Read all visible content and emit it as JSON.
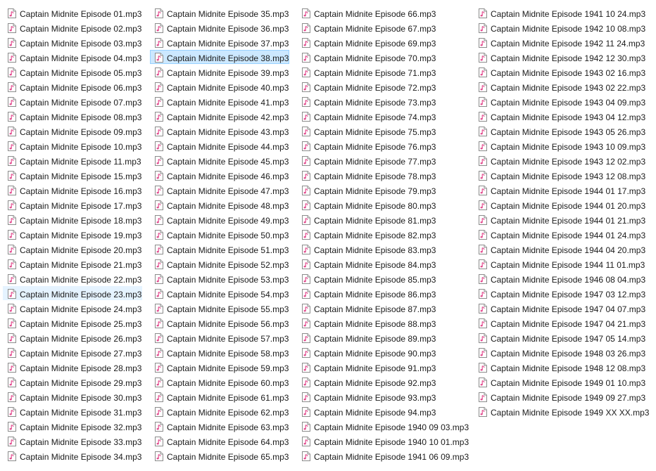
{
  "columns": [
    {
      "items": [
        "Captain Midnite Episode 01.mp3",
        "Captain Midnite Episode 02.mp3",
        "Captain Midnite Episode 03.mp3",
        "Captain Midnite Episode 04.mp3",
        "Captain Midnite Episode 05.mp3",
        "Captain Midnite Episode 06.mp3",
        "Captain Midnite Episode 07.mp3",
        "Captain Midnite Episode 08.mp3",
        "Captain Midnite Episode 09.mp3",
        "Captain Midnite Episode 10.mp3",
        "Captain Midnite Episode 11.mp3",
        "Captain Midnite Episode 15.mp3",
        "Captain Midnite Episode 16.mp3",
        "Captain Midnite Episode 17.mp3",
        "Captain Midnite Episode 18.mp3",
        "Captain Midnite Episode 19.mp3",
        "Captain Midnite Episode 20.mp3",
        "Captain Midnite Episode 21.mp3",
        "Captain Midnite Episode 22.mp3",
        "Captain Midnite Episode 23.mp3",
        "Captain Midnite Episode 24.mp3",
        "Captain Midnite Episode 25.mp3",
        "Captain Midnite Episode 26.mp3",
        "Captain Midnite Episode 27.mp3",
        "Captain Midnite Episode 28.mp3",
        "Captain Midnite Episode 29.mp3",
        "Captain Midnite Episode 30.mp3",
        "Captain Midnite Episode 31.mp3",
        "Captain Midnite Episode 32.mp3",
        "Captain Midnite Episode 33.mp3",
        "Captain Midnite Episode 34.mp3"
      ]
    },
    {
      "items": [
        "Captain Midnite Episode 35.mp3",
        "Captain Midnite Episode 36.mp3",
        "Captain Midnite Episode 37.mp3",
        "Captain Midnite Episode 38.mp3",
        "Captain Midnite Episode 39.mp3",
        "Captain Midnite Episode 40.mp3",
        "Captain Midnite Episode 41.mp3",
        "Captain Midnite Episode 42.mp3",
        "Captain Midnite Episode 43.mp3",
        "Captain Midnite Episode 44.mp3",
        "Captain Midnite Episode 45.mp3",
        "Captain Midnite Episode 46.mp3",
        "Captain Midnite Episode 47.mp3",
        "Captain Midnite Episode 48.mp3",
        "Captain Midnite Episode 49.mp3",
        "Captain Midnite Episode 50.mp3",
        "Captain Midnite Episode 51.mp3",
        "Captain Midnite Episode 52.mp3",
        "Captain Midnite Episode 53.mp3",
        "Captain Midnite Episode 54.mp3",
        "Captain Midnite Episode 55.mp3",
        "Captain Midnite Episode 56.mp3",
        "Captain Midnite Episode 57.mp3",
        "Captain Midnite Episode 58.mp3",
        "Captain Midnite Episode 59.mp3",
        "Captain Midnite Episode 60.mp3",
        "Captain Midnite Episode 61.mp3",
        "Captain Midnite Episode 62.mp3",
        "Captain Midnite Episode 63.mp3",
        "Captain Midnite Episode 64.mp3",
        "Captain Midnite Episode 65.mp3"
      ]
    },
    {
      "items": [
        "Captain Midnite Episode 66.mp3",
        "Captain Midnite Episode 67.mp3",
        "Captain Midnite Episode 69.mp3",
        "Captain Midnite Episode 70.mp3",
        "Captain Midnite Episode 71.mp3",
        "Captain Midnite Episode 72.mp3",
        "Captain Midnite Episode 73.mp3",
        "Captain Midnite Episode 74.mp3",
        "Captain Midnite Episode 75.mp3",
        "Captain Midnite Episode 76.mp3",
        "Captain Midnite Episode 77.mp3",
        "Captain Midnite Episode 78.mp3",
        "Captain Midnite Episode 79.mp3",
        "Captain Midnite Episode 80.mp3",
        "Captain Midnite Episode 81.mp3",
        "Captain Midnite Episode 82.mp3",
        "Captain Midnite Episode 83.mp3",
        "Captain Midnite Episode 84.mp3",
        "Captain Midnite Episode 85.mp3",
        "Captain Midnite Episode 86.mp3",
        "Captain Midnite Episode 87.mp3",
        "Captain Midnite Episode 88.mp3",
        "Captain Midnite Episode 89.mp3",
        "Captain Midnite Episode 90.mp3",
        "Captain Midnite Episode 91.mp3",
        "Captain Midnite Episode 92.mp3",
        "Captain Midnite Episode 93.mp3",
        "Captain Midnite Episode 94.mp3",
        "Captain Midnite Episode 1940 09 03.mp3",
        "Captain Midnite Episode 1940 10 01.mp3",
        "Captain Midnite Episode 1941 06 09.mp3"
      ]
    },
    {
      "items": [
        "Captain Midnite Episode 1941 10 24.mp3",
        "Captain Midnite Episode 1942 10 08.mp3",
        "Captain Midnite Episode 1942 11 24.mp3",
        "Captain Midnite Episode 1942 12 30.mp3",
        "Captain Midnite Episode 1943 02 16.mp3",
        "Captain Midnite Episode 1943 02 22.mp3",
        "Captain Midnite Episode 1943 04 09.mp3",
        "Captain Midnite Episode 1943 04 12.mp3",
        "Captain Midnite Episode 1943 05 26.mp3",
        "Captain Midnite Episode 1943 10 09.mp3",
        "Captain Midnite Episode 1943 12 02.mp3",
        "Captain Midnite Episode 1943 12 08.mp3",
        "Captain Midnite Episode 1944 01 17.mp3",
        "Captain Midnite Episode 1944 01 20.mp3",
        "Captain Midnite Episode 1944 01 21.mp3",
        "Captain Midnite Episode 1944 01 24.mp3",
        "Captain Midnite Episode 1944 04 20.mp3",
        "Captain Midnite Episode 1944 11 01.mp3",
        "Captain Midnite Episode 1946 08 04.mp3",
        "Captain Midnite Episode 1947 03 12.mp3",
        "Captain Midnite Episode 1947 04 07.mp3",
        "Captain Midnite Episode 1947 04 21.mp3",
        "Captain Midnite Episode 1947 05 14.mp3",
        "Captain Midnite Episode 1948 03 26.mp3",
        "Captain Midnite Episode 1948 12 08.mp3",
        "Captain Midnite Episode 1949 01 10.mp3",
        "Captain Midnite Episode 1949 09 27.mp3",
        "Captain Midnite Episode 1949 XX XX.mp3"
      ]
    }
  ],
  "selected_item": "Captain Midnite Episode 38.mp3",
  "hovered_item": "Captain Midnite Episode 23.mp3",
  "icon": "audio-file-icon",
  "colors": {
    "selection_bg": "#cce8ff",
    "selection_border": "#99d1ff",
    "hover_bg": "#e5f3ff",
    "icon_note": "#e24a8d"
  }
}
